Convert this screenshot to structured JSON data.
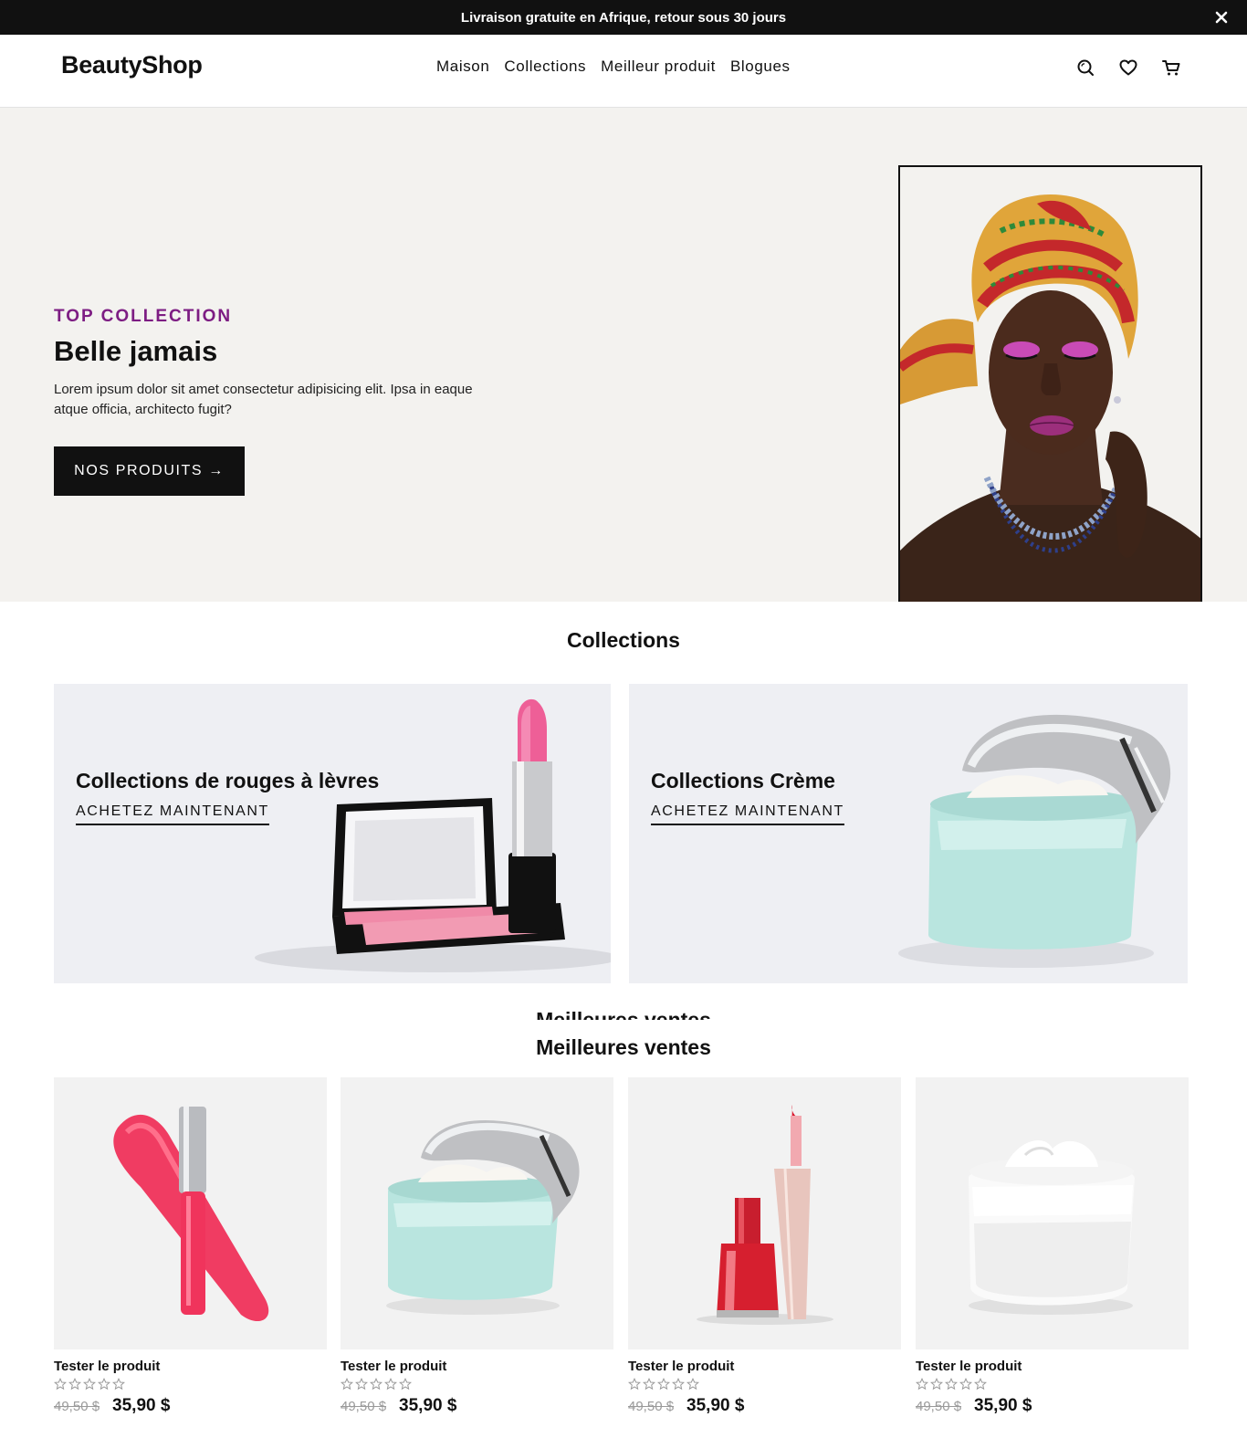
{
  "announcement": {
    "text": "Livraison gratuite en Afrique, retour sous 30 jours",
    "close_icon": "close-icon"
  },
  "header": {
    "logo": "BeautyShop",
    "nav": [
      "Maison",
      "Collections",
      "Meilleur produit",
      "Blogues"
    ],
    "icons": [
      "search-icon",
      "heart-icon",
      "cart-icon"
    ]
  },
  "hero": {
    "eyebrow": "TOP COLLECTION",
    "title": "Belle jamais",
    "description": "Lorem ipsum dolor sit amet consectetur adipisicing elit. Ipsa in eaque atque officia, architecto fugit?",
    "button": "NOS PRODUITS →",
    "image": "woman-headwrap-photo"
  },
  "collections": {
    "title": "Collections",
    "cards": [
      {
        "name": "Collections de rouges à lèvres",
        "link": "ACHETEZ MAINTENANT",
        "image": "lipstick-compact-photo"
      },
      {
        "name": "Collections Crème",
        "link": "ACHETEZ MAINTENANT",
        "image": "cream-jar-photo"
      }
    ]
  },
  "best_sellers": {
    "title": "Meilleures ventes",
    "products": [
      {
        "name": "Tester le produit",
        "old_price": "49,50 $",
        "new_price": "35,90 $",
        "rating": 0,
        "image": "lip-gloss-photo"
      },
      {
        "name": "Tester le produit",
        "old_price": "49,50 $",
        "new_price": "35,90 $",
        "rating": 0,
        "image": "mint-cream-jar-photo"
      },
      {
        "name": "Tester le produit",
        "old_price": "49,50 $",
        "new_price": "35,90 $",
        "rating": 0,
        "image": "nail-polish-photo"
      },
      {
        "name": "Tester le produit",
        "old_price": "49,50 $",
        "new_price": "35,90 $",
        "rating": 0,
        "image": "white-cream-jar-photo"
      }
    ]
  },
  "colors": {
    "accent": "#7d1d83",
    "dark": "#111111",
    "hero_bg": "#f3f2ef",
    "card_bg": "#eeeff3",
    "product_bg": "#f2f2f2"
  }
}
